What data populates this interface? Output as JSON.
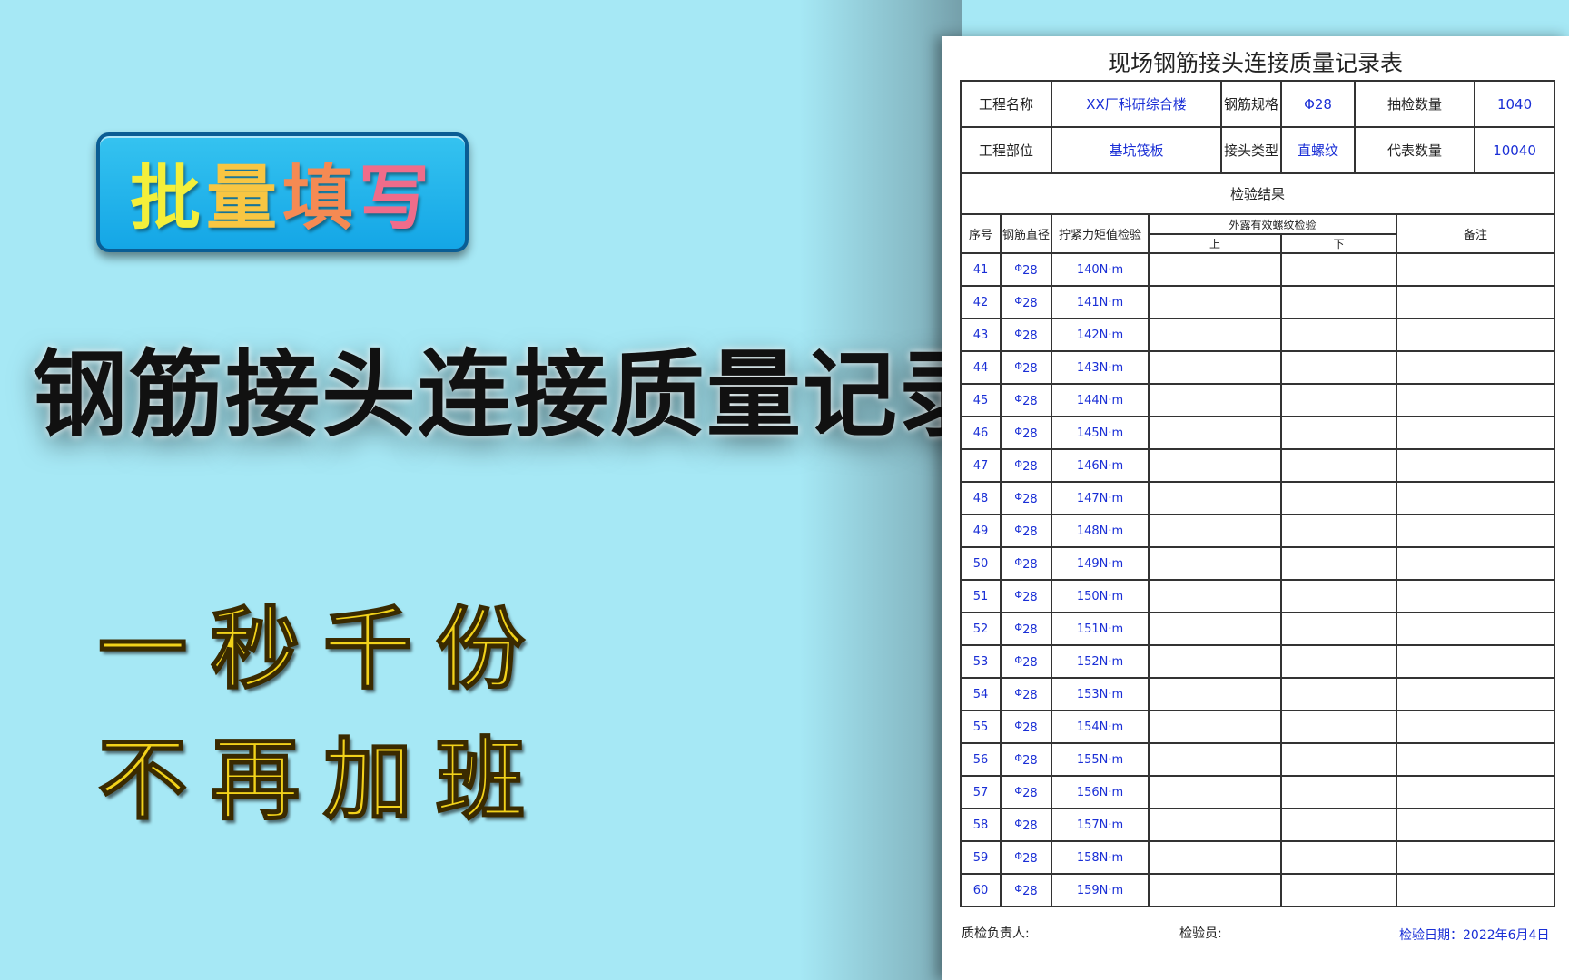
{
  "colors": {
    "background": "#a6e8f5",
    "badge": "#14a6e6",
    "slogan": "#f2d21a",
    "form_value": "#1a2fd6"
  },
  "badge": {
    "chars": [
      "批",
      "量",
      "填",
      "写"
    ]
  },
  "headline": "钢筋接头连接质量记录表",
  "slogan": {
    "line1": "一秒千份",
    "line2": "不再加班"
  },
  "document": {
    "title": "现场钢筋接头连接质量记录表",
    "info": {
      "project_name_label": "工程名称",
      "project_name_value": "XX厂科研综合楼",
      "rebar_spec_label": "钢筋规格",
      "rebar_spec_value": "Φ28",
      "sample_qty_label": "抽检数量",
      "sample_qty_value": "1040",
      "project_part_label": "工程部位",
      "project_part_value": "基坑筏板",
      "joint_type_label": "接头类型",
      "joint_type_value": "直螺纹",
      "rep_qty_label": "代表数量",
      "rep_qty_value": "10040"
    },
    "result_label": "检验结果",
    "columns": {
      "no": "序号",
      "diameter": "钢筋直径",
      "torque": "拧紧力矩值检验",
      "thread": "外露有效螺纹检验",
      "upper": "上",
      "lower": "下",
      "remark": "备注"
    },
    "rows": [
      {
        "no": "41",
        "phi": "Φ",
        "dia": "28",
        "torque": "140N·m"
      },
      {
        "no": "42",
        "phi": "Φ",
        "dia": "28",
        "torque": "141N·m"
      },
      {
        "no": "43",
        "phi": "Φ",
        "dia": "28",
        "torque": "142N·m"
      },
      {
        "no": "44",
        "phi": "Φ",
        "dia": "28",
        "torque": "143N·m"
      },
      {
        "no": "45",
        "phi": "Φ",
        "dia": "28",
        "torque": "144N·m"
      },
      {
        "no": "46",
        "phi": "Φ",
        "dia": "28",
        "torque": "145N·m"
      },
      {
        "no": "47",
        "phi": "Φ",
        "dia": "28",
        "torque": "146N·m"
      },
      {
        "no": "48",
        "phi": "Φ",
        "dia": "28",
        "torque": "147N·m"
      },
      {
        "no": "49",
        "phi": "Φ",
        "dia": "28",
        "torque": "148N·m"
      },
      {
        "no": "50",
        "phi": "Φ",
        "dia": "28",
        "torque": "149N·m"
      },
      {
        "no": "51",
        "phi": "Φ",
        "dia": "28",
        "torque": "150N·m"
      },
      {
        "no": "52",
        "phi": "Φ",
        "dia": "28",
        "torque": "151N·m"
      },
      {
        "no": "53",
        "phi": "Φ",
        "dia": "28",
        "torque": "152N·m"
      },
      {
        "no": "54",
        "phi": "Φ",
        "dia": "28",
        "torque": "153N·m"
      },
      {
        "no": "55",
        "phi": "Φ",
        "dia": "28",
        "torque": "154N·m"
      },
      {
        "no": "56",
        "phi": "Φ",
        "dia": "28",
        "torque": "155N·m"
      },
      {
        "no": "57",
        "phi": "Φ",
        "dia": "28",
        "torque": "156N·m"
      },
      {
        "no": "58",
        "phi": "Φ",
        "dia": "28",
        "torque": "157N·m"
      },
      {
        "no": "59",
        "phi": "Φ",
        "dia": "28",
        "torque": "158N·m"
      },
      {
        "no": "60",
        "phi": "Φ",
        "dia": "28",
        "torque": "159N·m"
      }
    ],
    "footer": {
      "qc_head_label": "质检负责人:",
      "inspector_label": "检验员:",
      "date_text": "检验日期：2022年6月4日"
    }
  }
}
